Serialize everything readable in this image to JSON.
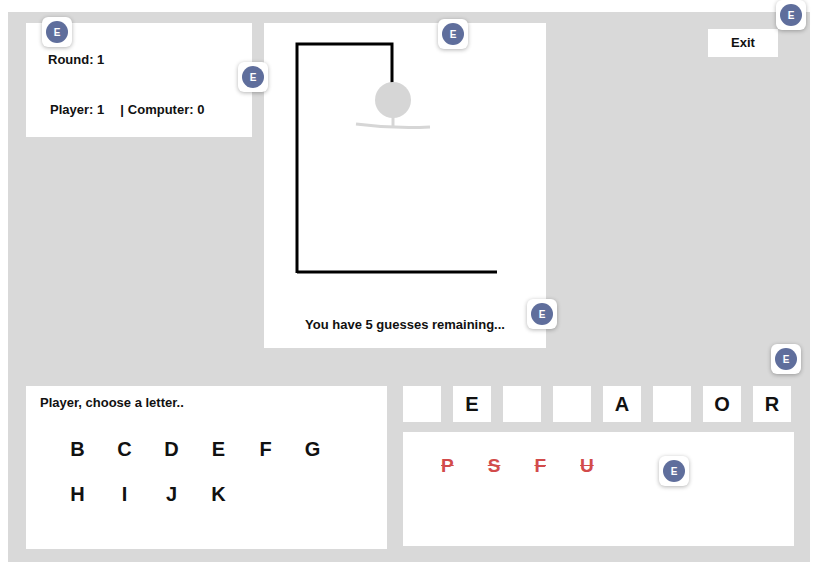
{
  "round": "Round: 1",
  "score": {
    "player": "Player: 1",
    "separator": "|",
    "computer": "Computer: 0"
  },
  "exit": "Exit",
  "hangman": {
    "parts": [
      {
        "part": "head",
        "shown": true
      },
      {
        "part": "neck",
        "shown": true
      },
      {
        "part": "arms",
        "shown": true
      }
    ]
  },
  "guesses_text": "You have 5 guesses remaining...",
  "prompt": "Player, choose a letter..",
  "letters": [
    "B",
    "C",
    "D",
    "E",
    "F",
    "G",
    "H",
    "I",
    "J",
    "K"
  ],
  "word": [
    {
      "letter": "",
      "revealed": false
    },
    {
      "letter": "E",
      "revealed": true
    },
    {
      "letter": "",
      "revealed": false
    },
    {
      "letter": "",
      "revealed": false
    },
    {
      "letter": "A",
      "revealed": true
    },
    {
      "letter": "",
      "revealed": false
    },
    {
      "letter": "O",
      "revealed": true
    },
    {
      "letter": "R",
      "revealed": true
    }
  ],
  "wrong_letters": [
    "P",
    "S",
    "F",
    "U"
  ],
  "comment_markers": [
    "E",
    "E",
    "E",
    "E",
    "E",
    "E",
    "E"
  ]
}
